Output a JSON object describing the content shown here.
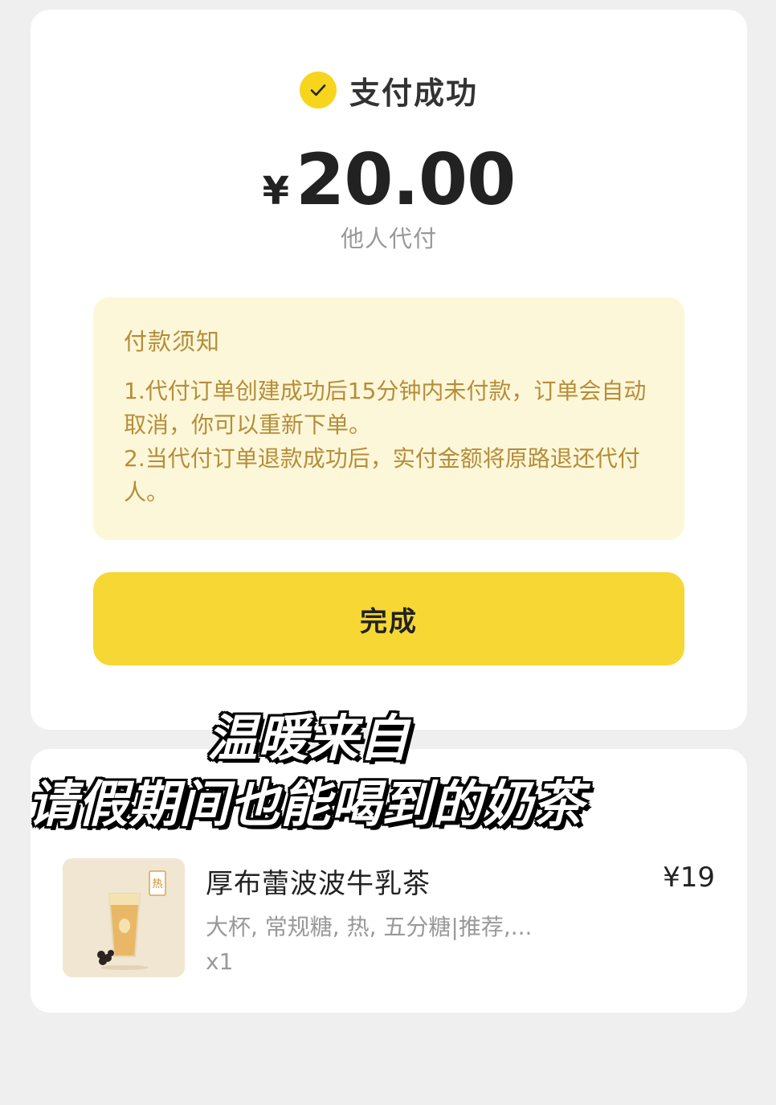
{
  "payment": {
    "status": "支付成功",
    "currency_symbol": "¥",
    "amount": "20.00",
    "method": "他人代付"
  },
  "notice": {
    "title": "付款须知",
    "item1": "1.代付订单创建成功后15分钟内未付款，订单会自动取消，你可以重新下单。",
    "item2": "2.当代付订单退款成功后，实付金额将原路退还代付人。"
  },
  "actions": {
    "done_label": "完成"
  },
  "order": {
    "product_name": "厚布蕾波波牛乳茶",
    "price": "¥19",
    "options": "大杯, 常规糖, 热, 五分糖|推荐,...",
    "quantity": "x1",
    "image_badge": "热"
  },
  "caption": {
    "line1": "温暖来自",
    "line2": "请假期间也能喝到的奶茶"
  },
  "colors": {
    "accent": "#f7d733",
    "notice_bg": "#fdf7d9",
    "notice_text": "#b58d3a",
    "page_bg": "#efefef"
  },
  "icons": {
    "status": "check-circle-icon"
  }
}
